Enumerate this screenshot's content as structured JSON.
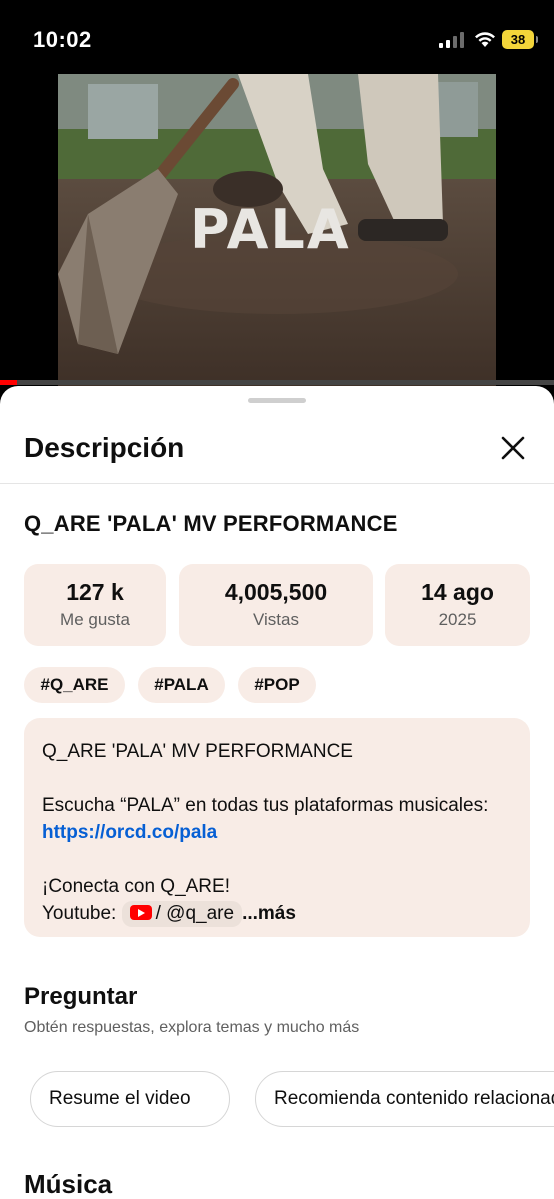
{
  "status_bar": {
    "time": "10:02",
    "battery": "38"
  },
  "video": {
    "overlay_title": "PALA",
    "progress_fraction": 0.03
  },
  "sheet": {
    "title": "Descripción",
    "video_title": "Q_ARE 'PALA' MV PERFORMANCE",
    "stats": [
      {
        "value": "127 k",
        "label": "Me gusta"
      },
      {
        "value": "4,005,500",
        "label": "Vistas"
      },
      {
        "value": "14 ago",
        "label": "2025"
      }
    ],
    "tags": [
      "#Q_ARE",
      "#PALA",
      "#POP"
    ],
    "description": {
      "line1": "Q_ARE 'PALA' MV PERFORMANCE",
      "line2_text": "Escucha “PALA” en todas tus plataformas musicales: ",
      "line2_link": "https://orcd.co/pala",
      "line3": "¡Conecta con Q_ARE!",
      "youtube_label": "Youtube:",
      "youtube_handle": "/ @q_are",
      "more": "...más"
    },
    "ask": {
      "title": "Preguntar",
      "subtitle": "Obtén respuestas, explora temas y mucho más",
      "chips": [
        "Resume el video",
        "Recomienda contenido relacionado"
      ]
    },
    "music_title": "Música"
  }
}
